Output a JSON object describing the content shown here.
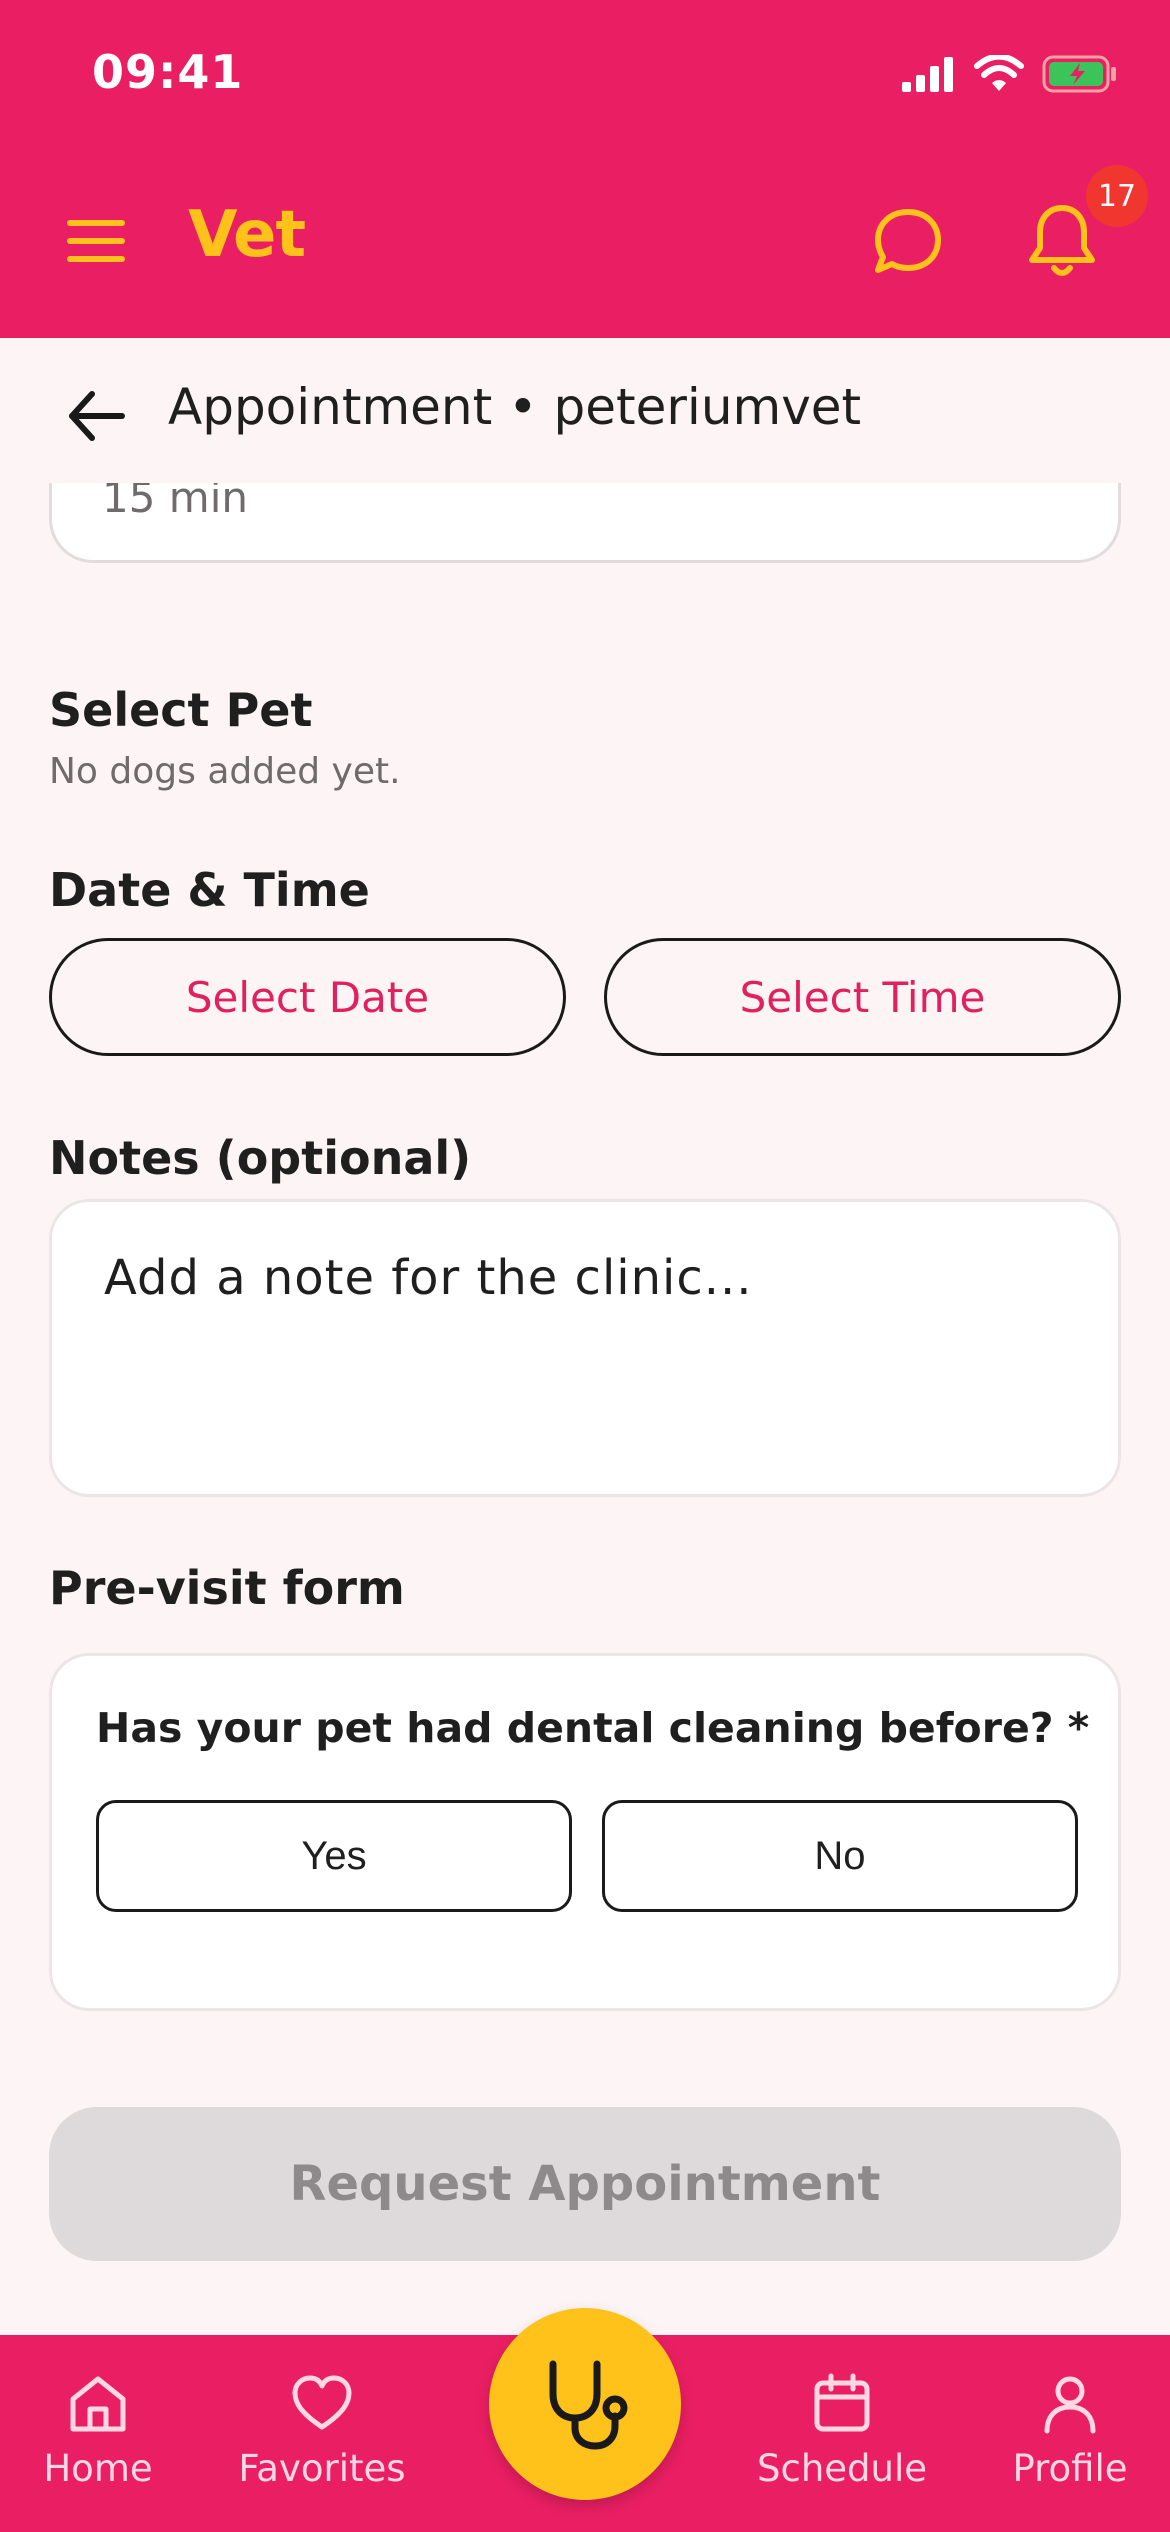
{
  "status_bar": {
    "time": "09:41"
  },
  "app_bar": {
    "brand": "Vet",
    "notification_count": "17"
  },
  "subheader": {
    "title": "Appointment • peteriumvet"
  },
  "service": {
    "duration": "15 min"
  },
  "select_pet": {
    "title": "Select Pet",
    "empty_text": "No dogs added yet."
  },
  "date_time": {
    "title": "Date & Time",
    "date_button": "Select Date",
    "time_button": "Select Time"
  },
  "notes": {
    "title": "Notes (optional)",
    "placeholder": "Add a note for the clinic..."
  },
  "previsit": {
    "title": "Pre-visit form",
    "question": "Has your pet had dental cleaning before? *",
    "yes": "Yes",
    "no": "No"
  },
  "submit": {
    "label": "Request Appointment"
  },
  "bottom_nav": {
    "home": "Home",
    "favorites": "Favorites",
    "schedule": "Schedule",
    "profile": "Profile"
  },
  "colors": {
    "primary": "#EA1F63",
    "accent": "#FFC21A",
    "badge": "#F0362F"
  },
  "icons": [
    "menu-icon",
    "chat-icon",
    "bell-icon",
    "back-arrow-icon",
    "home-icon",
    "heart-icon",
    "stethoscope-icon",
    "calendar-icon",
    "user-icon"
  ]
}
